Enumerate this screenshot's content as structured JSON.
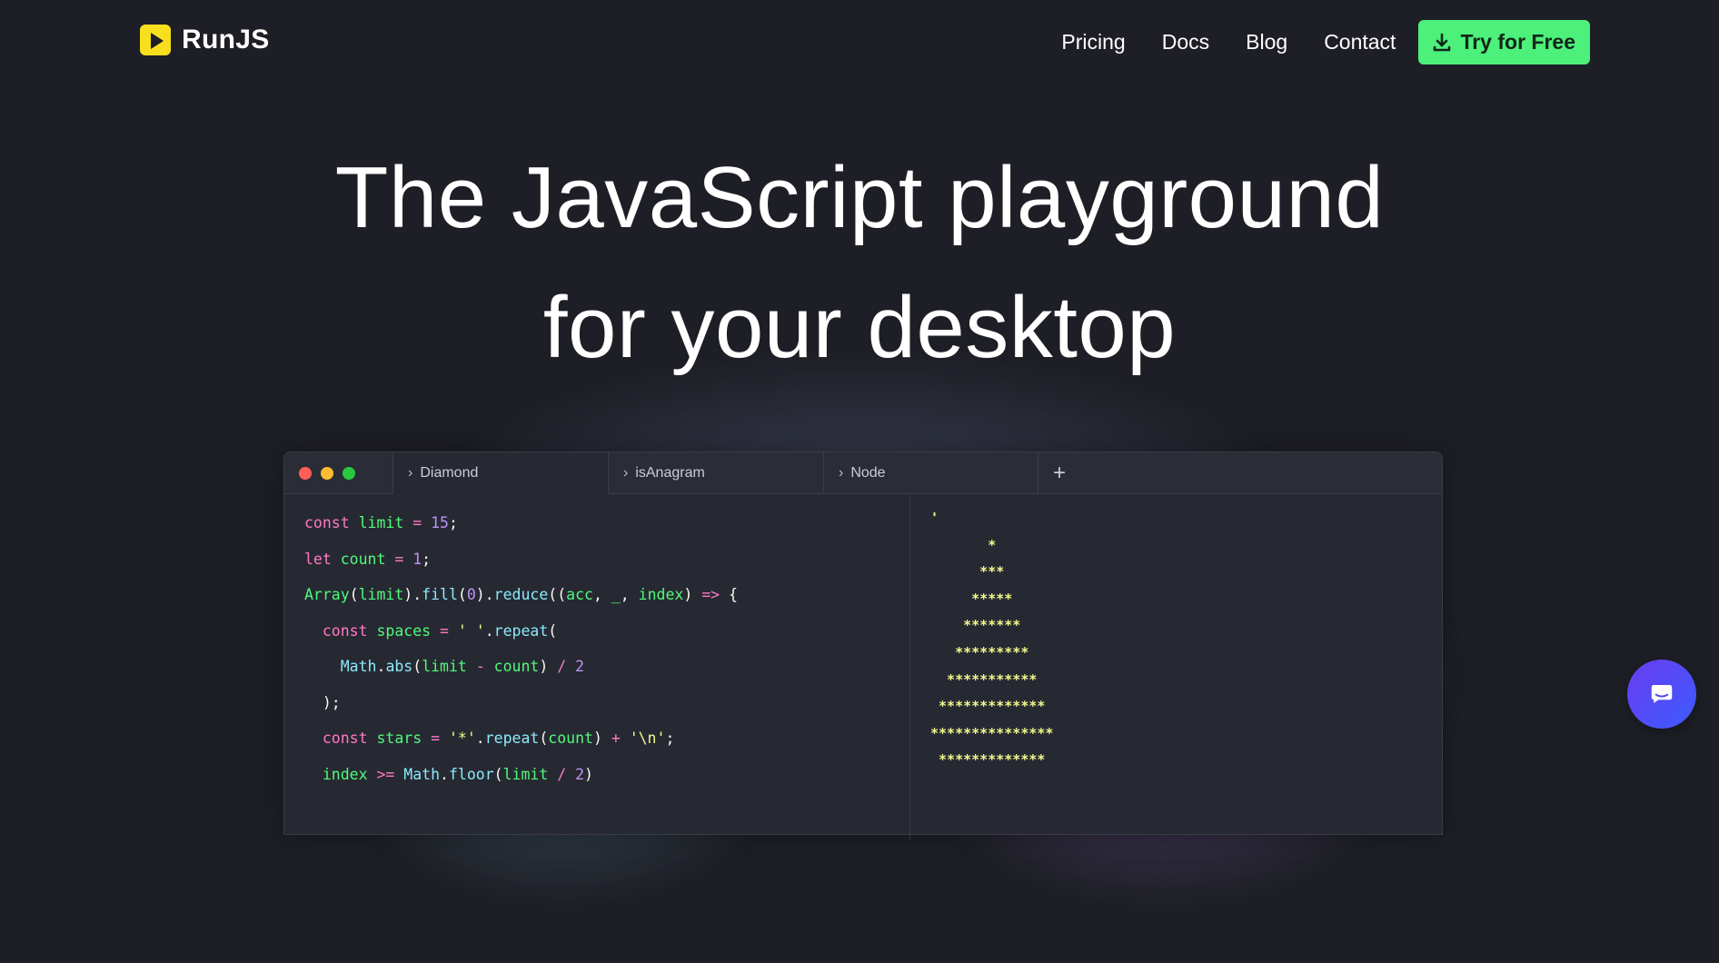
{
  "brand": {
    "name": "RunJS",
    "logo_icon": "play-icon",
    "logo_color": "#f7df1e"
  },
  "nav": {
    "links": [
      "Pricing",
      "Docs",
      "Blog",
      "Contact"
    ],
    "cta_label": "Try for Free",
    "cta_icon": "download-icon",
    "cta_color": "#4cf07a"
  },
  "hero": {
    "line1": "The JavaScript playground",
    "line2": "for your desktop"
  },
  "editor": {
    "tabs": [
      "Diamond",
      "isAnagram",
      "Node"
    ],
    "active_tab": "Diamond",
    "add_tab_label": "+",
    "code_lines": [
      "const limit = 15;",
      "let count = 1;",
      "Array(limit).fill(0).reduce((acc, _, index) => {",
      "  const spaces = ' '.repeat(",
      "    Math.abs(limit - count) / 2",
      "  );",
      "  const stars = '*'.repeat(count) + '\\n';",
      "  index >= Math.floor(limit / 2)"
    ],
    "output_lines": [
      "'",
      "       *",
      "      ***",
      "     *****",
      "    *******",
      "   *********",
      "  ***********",
      " *************",
      "***************",
      " *************"
    ]
  },
  "chat": {
    "icon": "chat-bubble-icon"
  }
}
